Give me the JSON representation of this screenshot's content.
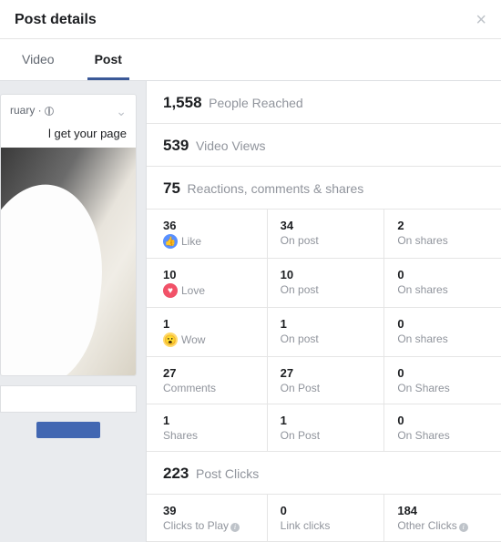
{
  "modal": {
    "title": "Post details"
  },
  "tabs": {
    "video": "Video",
    "post": "Post"
  },
  "post_preview": {
    "timestamp_fragment": "ruary",
    "text_fragment": "l get your page"
  },
  "stats": {
    "reached": {
      "value": "1,558",
      "label": "People Reached"
    },
    "views": {
      "value": "539",
      "label": "Video Views"
    },
    "engage": {
      "value": "75",
      "label": "Reactions, comments & shares"
    },
    "clicks": {
      "value": "223",
      "label": "Post Clicks"
    }
  },
  "reactions": {
    "like": {
      "total": "36",
      "label": "Like",
      "on_post": "34",
      "on_post_label": "On post",
      "on_shares": "2",
      "on_shares_label": "On shares"
    },
    "love": {
      "total": "10",
      "label": "Love",
      "on_post": "10",
      "on_post_label": "On post",
      "on_shares": "0",
      "on_shares_label": "On shares"
    },
    "wow": {
      "total": "1",
      "label": "Wow",
      "on_post": "1",
      "on_post_label": "On post",
      "on_shares": "0",
      "on_shares_label": "On shares"
    },
    "comments": {
      "total": "27",
      "label": "Comments",
      "on_post": "27",
      "on_post_label": "On Post",
      "on_shares": "0",
      "on_shares_label": "On Shares"
    },
    "shares": {
      "total": "1",
      "label": "Shares",
      "on_post": "1",
      "on_post_label": "On Post",
      "on_shares": "0",
      "on_shares_label": "On Shares"
    }
  },
  "clicks_breakdown": {
    "play": {
      "value": "39",
      "label": "Clicks to Play"
    },
    "link": {
      "value": "0",
      "label": "Link clicks"
    },
    "other": {
      "value": "184",
      "label": "Other Clicks"
    }
  }
}
